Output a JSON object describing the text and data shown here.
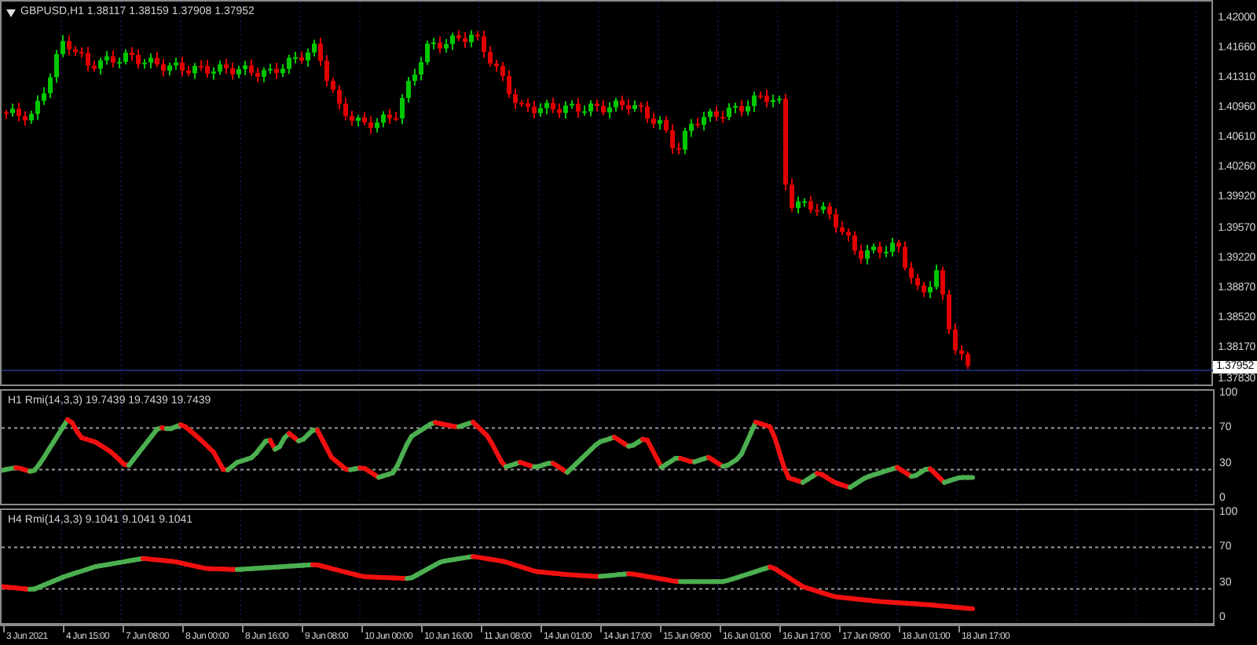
{
  "chart": {
    "title": "GBPUSD,H1  1.38117 1.38159 1.37908 1.37952",
    "price_ticks": [
      "1.42000",
      "1.41660",
      "1.41310",
      "1.40960",
      "1.40610",
      "1.40260",
      "1.39920",
      "1.39570",
      "1.39220",
      "1.38870",
      "1.38520",
      "1.38170"
    ],
    "current_price": "1.37952",
    "bottom_tick": "1.37830"
  },
  "indicators": [
    {
      "title": "H1 Rmi(14,3,3) 19.7439 19.7439 19.7439",
      "ticks": [
        "100",
        "70",
        "30",
        "0"
      ]
    },
    {
      "title": "H4 Rmi(14,3,3) 9.1041 9.1041 9.1041",
      "ticks": [
        "100",
        "70",
        "30",
        "0"
      ]
    }
  ],
  "time_axis": [
    "3 Jun 2021",
    "4 Jun 15:00",
    "7 Jun 08:00",
    "8 Jun 00:00",
    "8 Jun 16:00",
    "9 Jun 08:00",
    "10 Jun 00:00",
    "10 Jun 16:00",
    "11 Jun 08:00",
    "14 Jun 01:00",
    "14 Jun 17:00",
    "15 Jun 09:00",
    "16 Jun 01:00",
    "16 Jun 17:00",
    "17 Jun 09:00",
    "18 Jun 01:00",
    "18 Jun 17:00"
  ]
}
